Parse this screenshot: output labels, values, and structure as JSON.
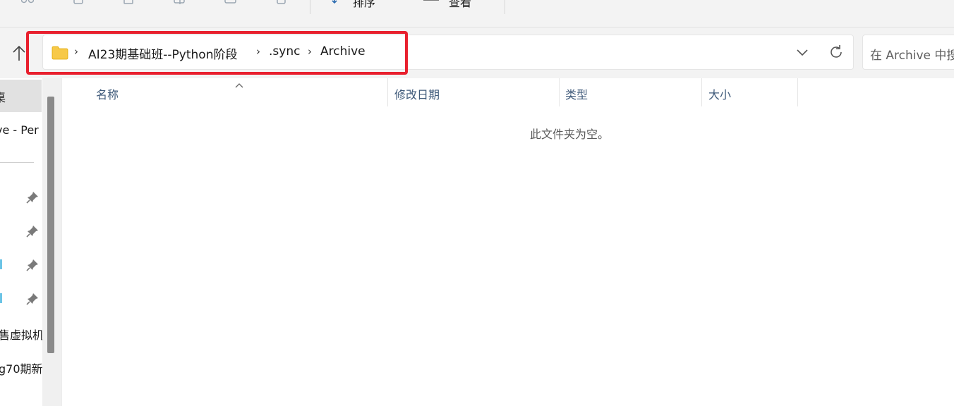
{
  "toolbar": {
    "sort_label": "排序",
    "view_label": "查看"
  },
  "address_bar": {
    "breadcrumbs": [
      "AI23期基础班--Python阶段",
      ".sync",
      "Archive"
    ]
  },
  "search": {
    "placeholder": "在 Archive 中搜"
  },
  "sidebar": {
    "items": [
      {
        "label": "桌"
      },
      {
        "label": "ve - Per"
      },
      {
        "label": "售虚拟机"
      },
      {
        "label": "g70期新"
      }
    ]
  },
  "file_list": {
    "columns": [
      {
        "label": "名称"
      },
      {
        "label": "修改日期"
      },
      {
        "label": "类型"
      },
      {
        "label": "大小"
      }
    ],
    "empty_message": "此文件夹为空。"
  },
  "colors": {
    "highlight": "#e8202e",
    "folder": "#f7c948",
    "accent_tick": "#6cc4e6",
    "header_text": "#3f5a7a"
  }
}
